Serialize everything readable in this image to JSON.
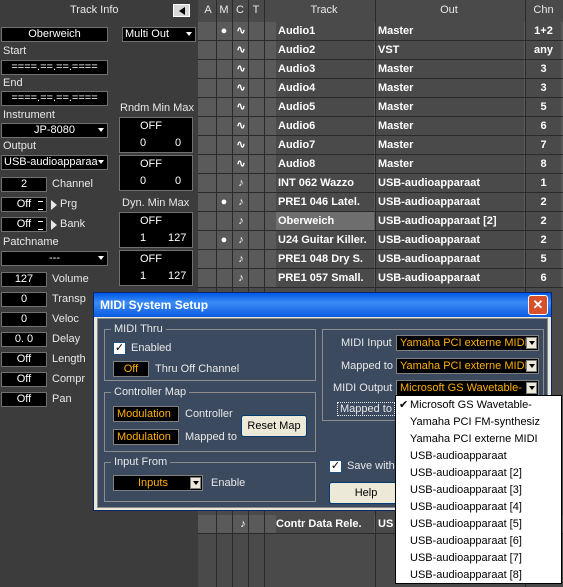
{
  "inspector": {
    "title": "Track Info",
    "collapse_icon": "triangle-left-icon",
    "track_name": "Oberweich",
    "multi_out": "Multi Out",
    "start_label": "Start",
    "start_value": "====.==.==.====",
    "end_label": "End",
    "end_value": "====.==.==.====",
    "instrument_label": "Instrument",
    "instrument_value": "JP-8080",
    "output_label": "Output",
    "output_value": "USB-audioapparaa",
    "rndm_label": "Rndm Min Max",
    "rndm_a_state": "OFF",
    "rndm_a_min": "0",
    "rndm_a_max": "0",
    "rndm_b_state": "OFF",
    "rndm_b_min": "0",
    "rndm_b_max": "0",
    "channel_value": "2",
    "channel_label": "Channel",
    "prg_value": "Off",
    "prg_label": "Prg",
    "bank_value": "Off",
    "bank_label": "Bank",
    "dyn_label": "Dyn. Min Max",
    "dyn_a_state": "OFF",
    "dyn_a_min": "1",
    "dyn_a_max": "127",
    "dyn_b_state": "OFF",
    "dyn_b_min": "1",
    "dyn_b_max": "127",
    "patchname_label": "Patchname",
    "patchname_value": "---",
    "volume_value": "127",
    "volume_label": "Volume",
    "transp_value": "0",
    "transp_label": "Transp",
    "veloc_value": "0",
    "veloc_label": "Veloc",
    "delay_value": "0.   0",
    "delay_label": "Delay",
    "length_value": "Off",
    "length_label": "Length",
    "compr_value": "Off",
    "compr_label": "Compr",
    "pan_value": "Off",
    "pan_label": "Pan"
  },
  "tracklist": {
    "headers": {
      "a": "A",
      "m": "M",
      "c": "C",
      "t": "T",
      "track": "Track",
      "out": "Out",
      "chn": "Chn"
    },
    "rows": [
      {
        "name": "Audio1",
        "out": "Master",
        "chn": "1+2",
        "type": "audio",
        "dot": true
      },
      {
        "name": "Audio2",
        "out": "VST",
        "chn": "any",
        "type": "audio",
        "dot": false
      },
      {
        "name": "Audio3",
        "out": "Master",
        "chn": "3",
        "type": "audio",
        "dot": false
      },
      {
        "name": "Audio4",
        "out": "Master",
        "chn": "3",
        "type": "audio",
        "dot": false
      },
      {
        "name": "Audio5",
        "out": "Master",
        "chn": "5",
        "type": "audio",
        "dot": false
      },
      {
        "name": "Audio6",
        "out": "Master",
        "chn": "6",
        "type": "audio",
        "dot": false
      },
      {
        "name": "Audio7",
        "out": "Master",
        "chn": "7",
        "type": "audio",
        "dot": false
      },
      {
        "name": "Audio8",
        "out": "Master",
        "chn": "8",
        "type": "audio",
        "dot": false
      },
      {
        "name": "INT 062 Wazzo",
        "out": "USB-audioapparaat",
        "chn": "1",
        "type": "midi",
        "dot": false
      },
      {
        "name": "PRE1 046 Latel.",
        "out": "USB-audioapparaat",
        "chn": "2",
        "type": "midi",
        "dot": true
      },
      {
        "name": "Oberweich",
        "out": "USB-audioapparaat [2]",
        "chn": "2",
        "type": "midi",
        "dot": false
      },
      {
        "name": "U24 Guitar Killer.",
        "out": "USB-audioapparaat",
        "chn": "2",
        "type": "midi",
        "dot": true
      },
      {
        "name": "PRE1 048 Dry S.",
        "out": "USB-audioapparaat",
        "chn": "5",
        "type": "midi",
        "dot": false
      },
      {
        "name": "PRE1 057 Small.",
        "out": "USB-audioapparaat",
        "chn": "6",
        "type": "midi",
        "dot": false
      }
    ],
    "bottom_row": {
      "name": "Contr Data Rele.",
      "out": "US"
    }
  },
  "dialog": {
    "title": "MIDI System Setup",
    "close_icon": "close-icon",
    "midi_thru_title": "MIDI Thru",
    "enabled_label": "Enabled",
    "enabled_checked": true,
    "thru_off_value": "Off",
    "thru_off_label": "Thru Off Channel",
    "controller_map_title": "Controller Map",
    "controller_value": "Modulation",
    "controller_label": "Controller",
    "mapped_value": "Modulation",
    "mapped_label": "Mapped to",
    "reset_map": "Reset Map",
    "input_from_title": "Input From",
    "inputs_value": "Inputs",
    "enable_label": "Enable",
    "midi_input_label": "MIDI Input",
    "midi_input_value": "Yamaha PCI externe MIDI",
    "mapped_to_label": "Mapped to",
    "mapped_to_value": "Yamaha PCI externe MIDI",
    "midi_output_label": "MIDI Output",
    "midi_output_value": "Microsoft GS Wavetable-",
    "mapped_to2_label": "Mapped to",
    "save_with_label": "Save with",
    "help_label": "Help"
  },
  "popup": {
    "options": [
      {
        "label": "Microsoft GS Wavetable-",
        "selected": true
      },
      {
        "label": "Yamaha PCI FM-synthesiz",
        "selected": false
      },
      {
        "label": "Yamaha PCI externe MIDI",
        "selected": false
      },
      {
        "label": "USB-audioapparaat",
        "selected": false
      },
      {
        "label": "USB-audioapparaat [2]",
        "selected": false
      },
      {
        "label": "USB-audioapparaat [3]",
        "selected": false
      },
      {
        "label": "USB-audioapparaat [4]",
        "selected": false
      },
      {
        "label": "USB-audioapparaat [5]",
        "selected": false
      },
      {
        "label": "USB-audioapparaat [6]",
        "selected": false
      },
      {
        "label": "USB-audioapparaat [7]",
        "selected": false
      },
      {
        "label": "USB-audioapparaat [8]",
        "selected": false
      }
    ],
    "check_glyph": "✔"
  },
  "colors": {
    "accent_orange": "#ffb000",
    "titlebar_blue": "#0058e6"
  }
}
